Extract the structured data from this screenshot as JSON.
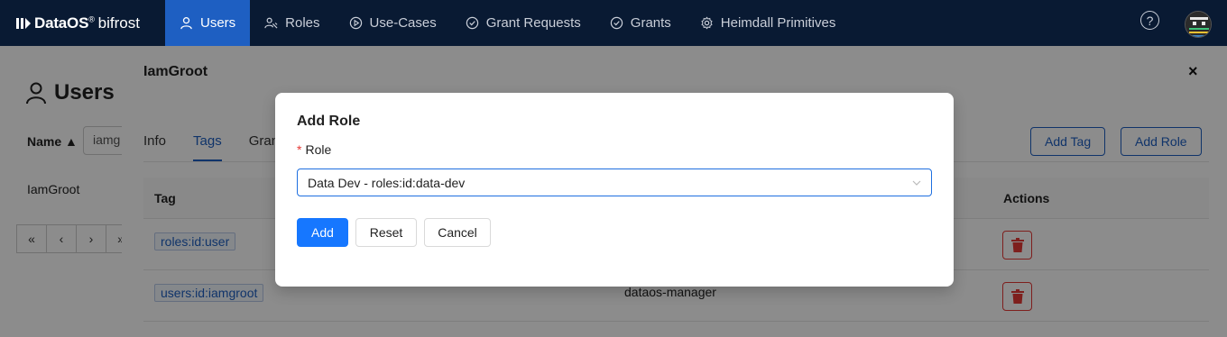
{
  "brand": {
    "name": "DataOS",
    "reg": "®",
    "sub": "bifrost"
  },
  "nav": {
    "items": [
      {
        "label": "Users",
        "icon": "user-icon",
        "active": true
      },
      {
        "label": "Roles",
        "icon": "roles-icon"
      },
      {
        "label": "Use-Cases",
        "icon": "play-circle-icon"
      },
      {
        "label": "Grant Requests",
        "icon": "check-circle-icon"
      },
      {
        "label": "Grants",
        "icon": "check-circle-icon"
      },
      {
        "label": "Heimdall Primitives",
        "icon": "gear-icon"
      }
    ],
    "help": "?"
  },
  "page": {
    "title": "Users",
    "filter_label": "Name ▲",
    "filter_value": "iamg",
    "row_name": "IamGroot",
    "pager": [
      "«",
      "‹",
      "›",
      "»"
    ]
  },
  "drawer": {
    "title": "IamGroot",
    "close": "×",
    "tabs": [
      "Info",
      "Tags",
      "Grants"
    ],
    "active_tab": "Tags",
    "add_tag": "Add Tag",
    "add_role": "Add Role",
    "columns": {
      "tag": "Tag",
      "actions": "Actions"
    },
    "rows": [
      {
        "tag": "roles:id:user",
        "text": ""
      },
      {
        "tag": "users:id:iamgroot",
        "text": "dataos-manager"
      }
    ]
  },
  "modal": {
    "title": "Add Role",
    "required_mark": "*",
    "field_label": "Role",
    "selected_value": "Data Dev - roles:id:data-dev",
    "buttons": {
      "add": "Add",
      "reset": "Reset",
      "cancel": "Cancel"
    }
  },
  "colors": {
    "nav_bg": "#091a33",
    "nav_active": "#1e5fc2",
    "primary": "#1677ff",
    "danger": "#e53935"
  }
}
